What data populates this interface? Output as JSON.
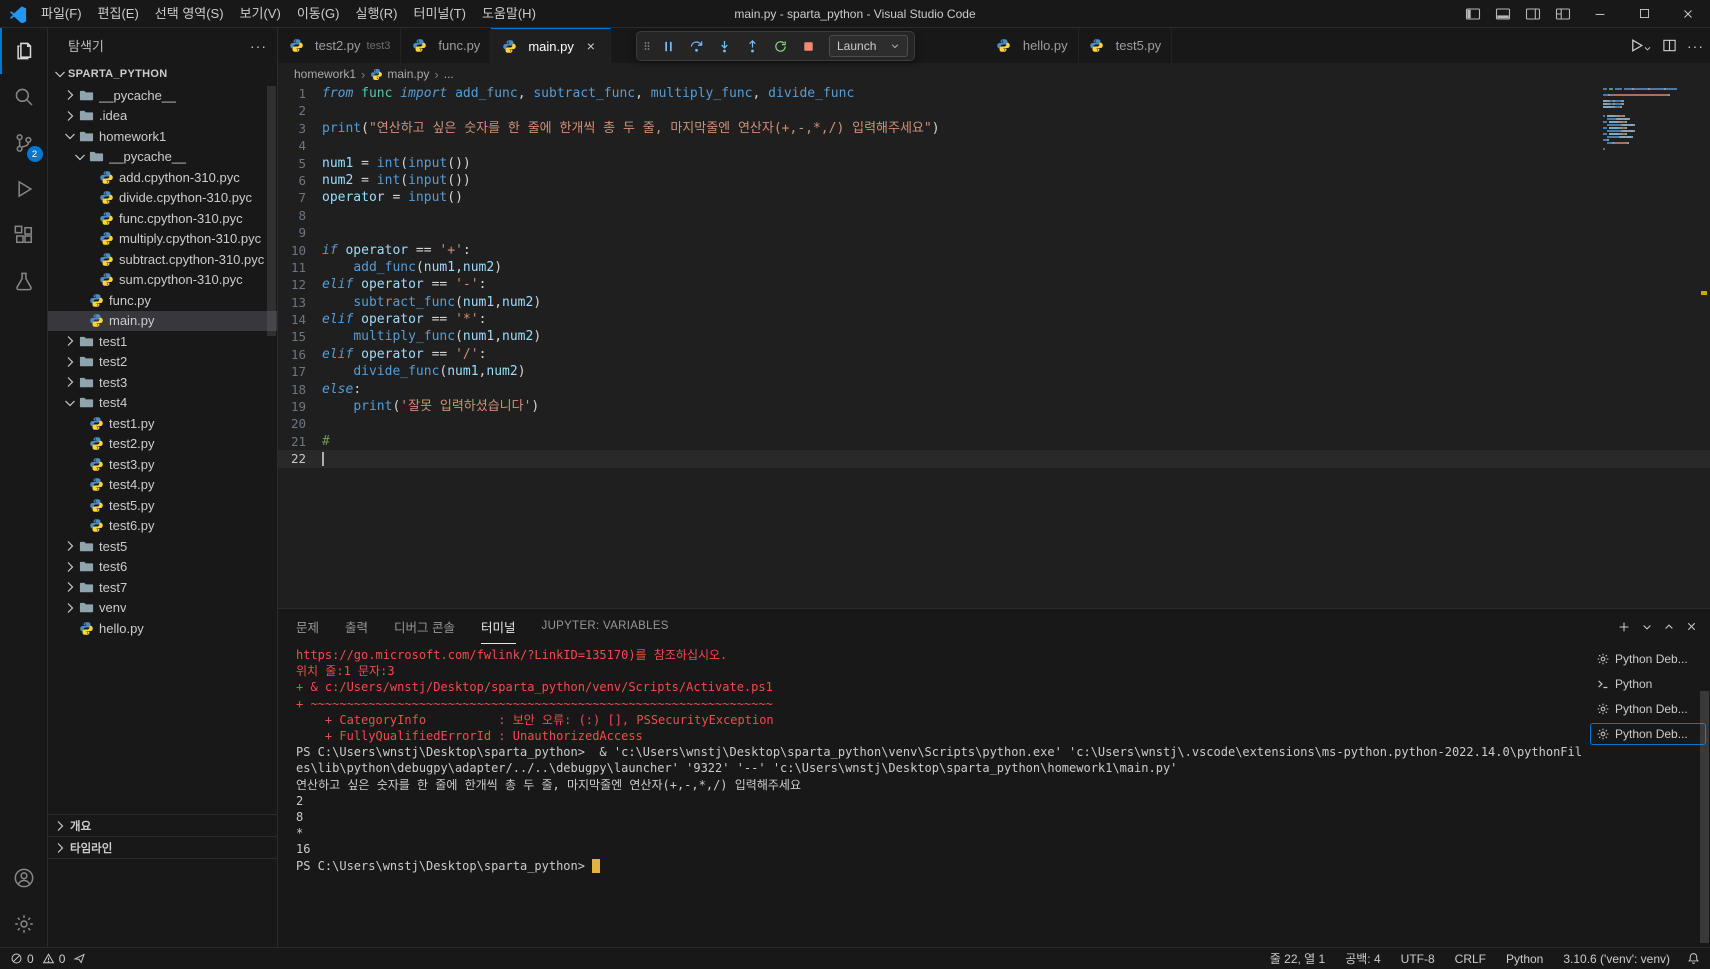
{
  "titlebar": {
    "title": "main.py - sparta_python - Visual Studio Code",
    "menus": [
      "파일(F)",
      "편집(E)",
      "선택 영역(S)",
      "보기(V)",
      "이동(G)",
      "실행(R)",
      "터미널(T)",
      "도움말(H)"
    ]
  },
  "activitybar": {
    "badge": "2"
  },
  "sidebar": {
    "header": "탐색기",
    "sections": [
      "개요",
      "타임라인"
    ],
    "tree": [
      {
        "label": "SPARTA_PYTHON",
        "depth": 0,
        "kind": "root",
        "state": "expanded"
      },
      {
        "label": "__pycache__",
        "depth": 1,
        "kind": "folder",
        "state": "collapsed"
      },
      {
        "label": ".idea",
        "depth": 1,
        "kind": "folder",
        "state": "collapsed"
      },
      {
        "label": "homework1",
        "depth": 1,
        "kind": "folder",
        "state": "expanded"
      },
      {
        "label": "__pycache__",
        "depth": 2,
        "kind": "folder",
        "state": "expanded"
      },
      {
        "label": "add.cpython-310.pyc",
        "depth": 3,
        "kind": "file"
      },
      {
        "label": "divide.cpython-310.pyc",
        "depth": 3,
        "kind": "file"
      },
      {
        "label": "func.cpython-310.pyc",
        "depth": 3,
        "kind": "file"
      },
      {
        "label": "multiply.cpython-310.pyc",
        "depth": 3,
        "kind": "file"
      },
      {
        "label": "subtract.cpython-310.pyc",
        "depth": 3,
        "kind": "file"
      },
      {
        "label": "sum.cpython-310.pyc",
        "depth": 3,
        "kind": "file"
      },
      {
        "label": "func.py",
        "depth": 2,
        "kind": "file"
      },
      {
        "label": "main.py",
        "depth": 2,
        "kind": "file",
        "selected": true
      },
      {
        "label": "test1",
        "depth": 1,
        "kind": "folder",
        "state": "collapsed"
      },
      {
        "label": "test2",
        "depth": 1,
        "kind": "folder",
        "state": "collapsed"
      },
      {
        "label": "test3",
        "depth": 1,
        "kind": "folder",
        "state": "collapsed"
      },
      {
        "label": "test4",
        "depth": 1,
        "kind": "folder",
        "state": "expanded"
      },
      {
        "label": "test1.py",
        "depth": 2,
        "kind": "file"
      },
      {
        "label": "test2.py",
        "depth": 2,
        "kind": "file"
      },
      {
        "label": "test3.py",
        "depth": 2,
        "kind": "file"
      },
      {
        "label": "test4.py",
        "depth": 2,
        "kind": "file"
      },
      {
        "label": "test5.py",
        "depth": 2,
        "kind": "file"
      },
      {
        "label": "test6.py",
        "depth": 2,
        "kind": "file"
      },
      {
        "label": "test5",
        "depth": 1,
        "kind": "folder",
        "state": "collapsed"
      },
      {
        "label": "test6",
        "depth": 1,
        "kind": "folder",
        "state": "collapsed"
      },
      {
        "label": "test7",
        "depth": 1,
        "kind": "folder",
        "state": "collapsed"
      },
      {
        "label": "venv",
        "depth": 1,
        "kind": "folder",
        "state": "collapsed"
      },
      {
        "label": "hello.py",
        "depth": 1,
        "kind": "file"
      }
    ]
  },
  "editor": {
    "tabs": [
      {
        "label": "test2.py",
        "desc": "test3"
      },
      {
        "label": "func.py"
      },
      {
        "label": "main.py",
        "active": true
      },
      {
        "label": "hello.py",
        "gap_before": true
      },
      {
        "label": "test5.py"
      }
    ],
    "breadcrumb": [
      "homework1",
      "main.py",
      "..."
    ],
    "debug_toolbar": {
      "launch_label": "Launch"
    },
    "current_line": 22,
    "lines": [
      {
        "n": 1,
        "segs": [
          [
            "k",
            "from"
          ],
          [
            "p",
            " "
          ],
          [
            "t",
            "func"
          ],
          [
            "p",
            " "
          ],
          [
            "k",
            "import"
          ],
          [
            "p",
            " "
          ],
          [
            "b",
            "add_func"
          ],
          [
            "p",
            ", "
          ],
          [
            "b",
            "subtract_func"
          ],
          [
            "p",
            ", "
          ],
          [
            "b",
            "multiply_func"
          ],
          [
            "p",
            ", "
          ],
          [
            "b",
            "divide_func"
          ]
        ]
      },
      {
        "n": 2,
        "segs": []
      },
      {
        "n": 3,
        "segs": [
          [
            "b",
            "print"
          ],
          [
            "p",
            "("
          ],
          [
            "s",
            "\"연산하고 싶은 숫자를 한 줄에 한개씩 총 두 줄, 마지막줄엔 연산자(+,-,*,/) 입력해주세요\""
          ],
          [
            "p",
            ")"
          ]
        ]
      },
      {
        "n": 4,
        "segs": []
      },
      {
        "n": 5,
        "segs": [
          [
            "v",
            "num1"
          ],
          [
            "p",
            " = "
          ],
          [
            "b",
            "int"
          ],
          [
            "p",
            "("
          ],
          [
            "b",
            "input"
          ],
          [
            "p",
            "())"
          ]
        ]
      },
      {
        "n": 6,
        "segs": [
          [
            "v",
            "num2"
          ],
          [
            "p",
            " = "
          ],
          [
            "b",
            "int"
          ],
          [
            "p",
            "("
          ],
          [
            "b",
            "input"
          ],
          [
            "p",
            "())"
          ]
        ]
      },
      {
        "n": 7,
        "segs": [
          [
            "v",
            "operator"
          ],
          [
            "p",
            " = "
          ],
          [
            "b",
            "input"
          ],
          [
            "p",
            "()"
          ]
        ]
      },
      {
        "n": 8,
        "segs": []
      },
      {
        "n": 9,
        "segs": []
      },
      {
        "n": 10,
        "segs": [
          [
            "k",
            "if"
          ],
          [
            "p",
            " "
          ],
          [
            "v",
            "operator"
          ],
          [
            "p",
            " == "
          ],
          [
            "s",
            "'+'"
          ],
          [
            "p",
            ":"
          ]
        ]
      },
      {
        "n": 11,
        "segs": [
          [
            "p",
            "    "
          ],
          [
            "b",
            "add_func"
          ],
          [
            "p",
            "("
          ],
          [
            "v",
            "num1"
          ],
          [
            "p",
            ","
          ],
          [
            "v",
            "num2"
          ],
          [
            "p",
            ")"
          ]
        ]
      },
      {
        "n": 12,
        "segs": [
          [
            "k",
            "elif"
          ],
          [
            "p",
            " "
          ],
          [
            "v",
            "operator"
          ],
          [
            "p",
            " == "
          ],
          [
            "s",
            "'-'"
          ],
          [
            "p",
            ":"
          ]
        ]
      },
      {
        "n": 13,
        "segs": [
          [
            "p",
            "    "
          ],
          [
            "b",
            "subtract_func"
          ],
          [
            "p",
            "("
          ],
          [
            "v",
            "num1"
          ],
          [
            "p",
            ","
          ],
          [
            "v",
            "num2"
          ],
          [
            "p",
            ")"
          ]
        ]
      },
      {
        "n": 14,
        "segs": [
          [
            "k",
            "elif"
          ],
          [
            "p",
            " "
          ],
          [
            "v",
            "operator"
          ],
          [
            "p",
            " == "
          ],
          [
            "s",
            "'*'"
          ],
          [
            "p",
            ":"
          ]
        ]
      },
      {
        "n": 15,
        "segs": [
          [
            "p",
            "    "
          ],
          [
            "b",
            "multiply_func"
          ],
          [
            "p",
            "("
          ],
          [
            "v",
            "num1"
          ],
          [
            "p",
            ","
          ],
          [
            "v",
            "num2"
          ],
          [
            "p",
            ")"
          ]
        ]
      },
      {
        "n": 16,
        "segs": [
          [
            "k",
            "elif"
          ],
          [
            "p",
            " "
          ],
          [
            "v",
            "operator"
          ],
          [
            "p",
            " == "
          ],
          [
            "s",
            "'/'"
          ],
          [
            "p",
            ":"
          ]
        ]
      },
      {
        "n": 17,
        "segs": [
          [
            "p",
            "    "
          ],
          [
            "b",
            "divide_func"
          ],
          [
            "p",
            "("
          ],
          [
            "v",
            "num1"
          ],
          [
            "p",
            ","
          ],
          [
            "v",
            "num2"
          ],
          [
            "p",
            ")"
          ]
        ]
      },
      {
        "n": 18,
        "segs": [
          [
            "k",
            "else"
          ],
          [
            "p",
            ":"
          ]
        ]
      },
      {
        "n": 19,
        "segs": [
          [
            "p",
            "    "
          ],
          [
            "b",
            "print"
          ],
          [
            "p",
            "("
          ],
          [
            "s",
            "'잘못 입력하셨습니다'"
          ],
          [
            "p",
            ")"
          ]
        ]
      },
      {
        "n": 20,
        "segs": []
      },
      {
        "n": 21,
        "segs": [
          [
            "c",
            "#"
          ]
        ]
      },
      {
        "n": 22,
        "segs": []
      }
    ]
  },
  "panel": {
    "tabs": [
      {
        "label": "문제"
      },
      {
        "label": "출력"
      },
      {
        "label": "디버그 콘솔"
      },
      {
        "label": "터미널",
        "active": true
      },
      {
        "label": "JUPYTER: VARIABLES",
        "caps": true
      }
    ],
    "terminal_lines": [
      {
        "c": "red",
        "t": "https://go.microsoft.com/fwlink/?LinkID=135170)를 참조하십시오."
      },
      {
        "c": "red",
        "t": "위치 줄:1 문자:3"
      },
      {
        "c": "red",
        "t": "+ & c:/Users/wnstj/Desktop/sparta_python/venv/Scripts/Activate.ps1"
      },
      {
        "c": "red",
        "t": "+ ~~~~~~~~~~~~~~~~~~~~~~~~~~~~~~~~~~~~~~~~~~~~~~~~~~~~~~~~~~~~~~~~"
      },
      {
        "c": "red",
        "t": "    + CategoryInfo          : 보안 오류: (:) [], PSSecurityException"
      },
      {
        "c": "red",
        "t": "    + FullyQualifiedErrorId : UnauthorizedAccess"
      },
      {
        "c": "fg",
        "t": "PS C:\\Users\\wnstj\\Desktop\\sparta_python>  & 'c:\\Users\\wnstj\\Desktop\\sparta_python\\venv\\Scripts\\python.exe' 'c:\\Users\\wnstj\\.vscode\\extensions\\ms-python.python-2022.14.0\\pythonFil"
      },
      {
        "c": "fg",
        "t": "es\\lib\\python\\debugpy\\adapter/../..\\debugpy\\launcher' '9322' '--' 'c:\\Users\\wnstj\\Desktop\\sparta_python\\homework1\\main.py'"
      },
      {
        "c": "fg",
        "t": "연산하고 싶은 숫자를 한 줄에 한개씩 총 두 줄, 마지막줄엔 연산자(+,-,*,/) 입력해주세요"
      },
      {
        "c": "fg",
        "t": "2"
      },
      {
        "c": "fg",
        "t": "8"
      },
      {
        "c": "fg",
        "t": "*"
      },
      {
        "c": "fg",
        "t": "16"
      },
      {
        "c": "fg",
        "t": "PS C:\\Users\\wnstj\\Desktop\\sparta_python> ",
        "cursor": true
      }
    ],
    "terminal_list": [
      {
        "icon": "gear",
        "label": "Python Deb..."
      },
      {
        "icon": "terminal",
        "label": "Python"
      },
      {
        "icon": "gear",
        "label": "Python Deb..."
      },
      {
        "icon": "gear",
        "label": "Python Deb...",
        "active": true
      }
    ]
  },
  "statusbar": {
    "errors": "0",
    "warnings": "0",
    "right": [
      "줄 22, 열 1",
      "공백: 4",
      "UTF-8",
      "CRLF",
      "Python",
      "3.10.6 ('venv': venv)"
    ]
  }
}
